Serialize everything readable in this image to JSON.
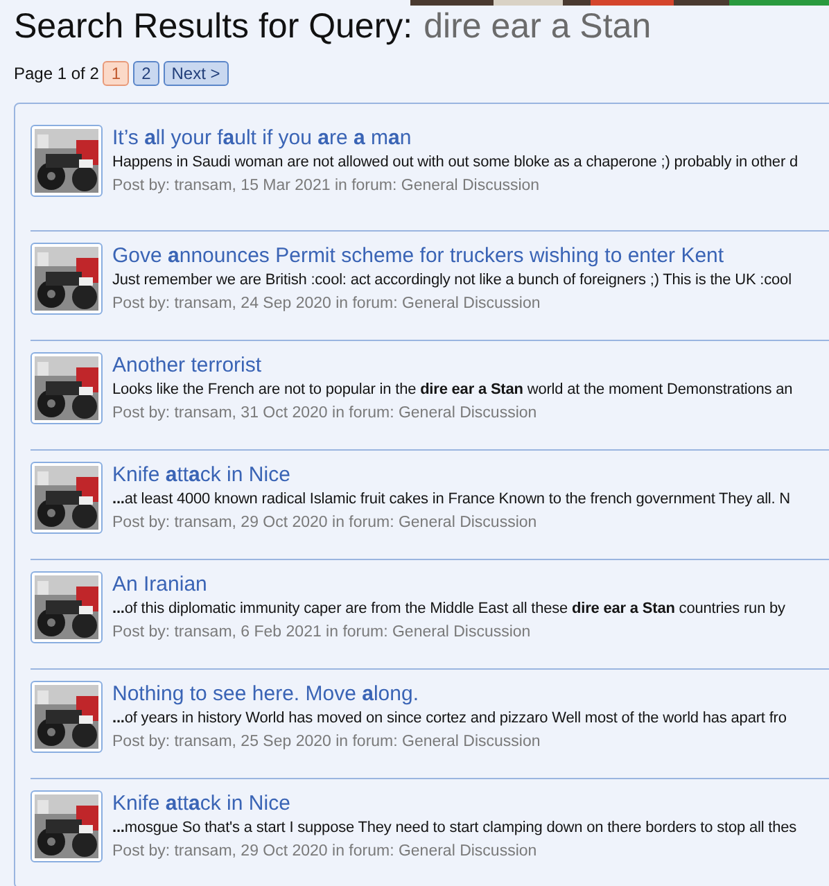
{
  "heading": {
    "label": "Search Results for Query:",
    "query": "dire ear a Stan"
  },
  "pagination": {
    "summary": "Page 1 of 2",
    "pages": [
      {
        "label": "1",
        "selected": true
      },
      {
        "label": "2",
        "selected": false
      }
    ],
    "next": "Next >"
  },
  "results": [
    {
      "title": "It’s **a**ll your f**a**ult if you **a**re **a** m**a**n",
      "snippet": "Happens in Saudi woman are not allowed out with out some bloke as a chaperone ;) probably in other d",
      "meta": "Post by: transam, 15 Mar 2021 in forum: General Discussion"
    },
    {
      "title": "Gove **a**nnounces Permit scheme for truckers wishing to enter Kent",
      "snippet": "Just remember we are British :cool: act accordingly not like a bunch of foreigners ;) This is the UK :cool",
      "meta": "Post by: transam, 24 Sep 2020 in forum: General Discussion"
    },
    {
      "title": "Another terrorist",
      "snippet": "Looks like the French are not to popular in the **dire ear a Stan** world at the moment Demonstrations an",
      "meta": "Post by: transam, 31 Oct 2020 in forum: General Discussion"
    },
    {
      "title": "Knife **a**tt**a**ck in Nice",
      "snippet": "**...**at least 4000 known radical Islamic fruit cakes in France Known to the french government They all. N",
      "meta": "Post by: transam, 29 Oct 2020 in forum: General Discussion"
    },
    {
      "title": "An Iranian",
      "snippet": "**...**of this diplomatic immunity caper are from the Middle East all these **dire ear a Stan** countries run by",
      "meta": "Post by: transam, 6 Feb 2021 in forum: General Discussion"
    },
    {
      "title": "Nothing to see here. Move **a**long.",
      "snippet": "**...**of years in history World has moved on since cortez and pizzaro Well most of the world has apart fro",
      "meta": "Post by: transam, 25 Sep 2020 in forum: General Discussion"
    },
    {
      "title": "Knife **a**tt**a**ck in Nice",
      "snippet": "**...**mosgue So that's a start I suppose They need to start clamping down on there borders to stop all thes",
      "meta": "Post by: transam, 29 Oct 2020 in forum: General Discussion"
    }
  ]
}
